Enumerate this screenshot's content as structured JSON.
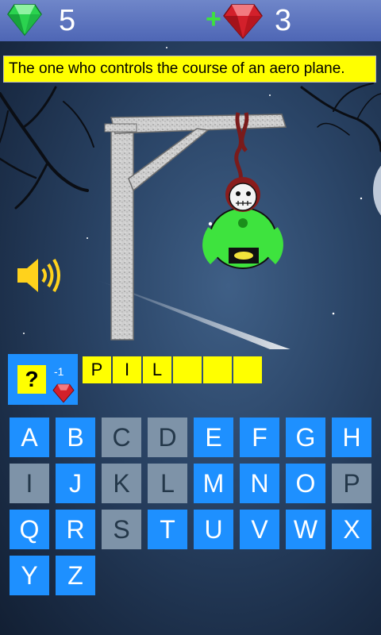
{
  "header": {
    "emeralds": "5",
    "plus": "+",
    "rubies": "3"
  },
  "clue": "The one who controls the course of an aero plane.",
  "hint": {
    "label": "?",
    "cost": "-1"
  },
  "answer_slots": [
    "P",
    "I",
    "L",
    "",
    "",
    ""
  ],
  "keyboard": [
    {
      "letter": "A",
      "state": "available"
    },
    {
      "letter": "B",
      "state": "available"
    },
    {
      "letter": "C",
      "state": "used"
    },
    {
      "letter": "D",
      "state": "used"
    },
    {
      "letter": "E",
      "state": "available"
    },
    {
      "letter": "F",
      "state": "available"
    },
    {
      "letter": "G",
      "state": "available"
    },
    {
      "letter": "H",
      "state": "available"
    },
    {
      "letter": "I",
      "state": "used"
    },
    {
      "letter": "J",
      "state": "available"
    },
    {
      "letter": "K",
      "state": "used"
    },
    {
      "letter": "L",
      "state": "used"
    },
    {
      "letter": "M",
      "state": "available"
    },
    {
      "letter": "N",
      "state": "available"
    },
    {
      "letter": "O",
      "state": "available"
    },
    {
      "letter": "P",
      "state": "used"
    },
    {
      "letter": "Q",
      "state": "available"
    },
    {
      "letter": "R",
      "state": "available"
    },
    {
      "letter": "S",
      "state": "used"
    },
    {
      "letter": "T",
      "state": "available"
    },
    {
      "letter": "U",
      "state": "available"
    },
    {
      "letter": "V",
      "state": "available"
    },
    {
      "letter": "W",
      "state": "available"
    },
    {
      "letter": "X",
      "state": "available"
    },
    {
      "letter": "Y",
      "state": "available"
    },
    {
      "letter": "Z",
      "state": "available"
    }
  ],
  "colors": {
    "key_available": "#1e90ff",
    "key_used": "#7e93a8",
    "answer_slot": "#ffff00",
    "clue_background": "#ffff00",
    "top_bar": "#5b73bf"
  },
  "icons": [
    "emerald-icon",
    "ruby-icon",
    "speaker-icon",
    "hint-ruby-icon"
  ]
}
